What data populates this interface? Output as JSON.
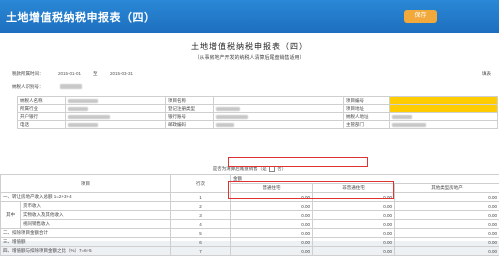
{
  "window": {
    "title": "土地增值税纳税申报表（四）",
    "button_label": "保存"
  },
  "form": {
    "title": "土地增值税纳税申报表（四）",
    "subtitle": "（从事房地产开发的纳税人清算后尾盘销售适用）",
    "period_label": "税款所属时间：",
    "period_start": "2015-01-01",
    "period_to": "至",
    "period_end": "2015-03-31",
    "fill_date_label": "填表",
    "taxpayer_id_label": "纳税人识别号："
  },
  "info_rows": [
    [
      "纳税人名称",
      "",
      "项目名称",
      "",
      "项目编号",
      ""
    ],
    [
      "所属行业",
      "",
      "登记注册类型",
      "",
      "项目地址",
      ""
    ],
    [
      "开户银行",
      "",
      "银行账号",
      "",
      "纳税人地址",
      ""
    ],
    [
      "电话",
      "",
      "邮政编码",
      "",
      "主管部门",
      ""
    ]
  ],
  "line_text": "是否为清算后尾盘销售（是",
  "line_text_no": "否）",
  "main_table": {
    "col_item": "项目",
    "col_row": "行次",
    "col_amount": "金额",
    "sub_cols": [
      "普通住宅",
      "非普通住宅",
      "其他类型房地产"
    ],
    "rows": [
      {
        "item": "一、转让房地产收入总额 1=2+3+4",
        "row": "1",
        "vals": [
          "0.00",
          "0.00",
          "0.00"
        ]
      },
      {
        "group": "其中",
        "item": "货币收入",
        "row": "2",
        "vals": [
          "0.00",
          "0.00",
          "0.00"
        ]
      },
      {
        "item": "实物收入及其他收入",
        "row": "3",
        "vals": [
          "0.00",
          "0.00",
          "0.00"
        ]
      },
      {
        "item": "视同销售收入",
        "row": "4",
        "vals": [
          "0.00",
          "0.00",
          "0.00"
        ]
      },
      {
        "item": "二、扣除项目金额合计",
        "row": "5",
        "vals": [
          "0.00",
          "0.00",
          "0.00"
        ]
      },
      {
        "item": "三、增值额",
        "row": "6",
        "vals": [
          "0.00",
          "0.00",
          "0.00"
        ]
      },
      {
        "item": "四、增值额与扣除项目金额之比（%）7=6÷5",
        "row": "7",
        "vals": [
          "0.00",
          "0.00",
          "0.00"
        ]
      }
    ]
  }
}
